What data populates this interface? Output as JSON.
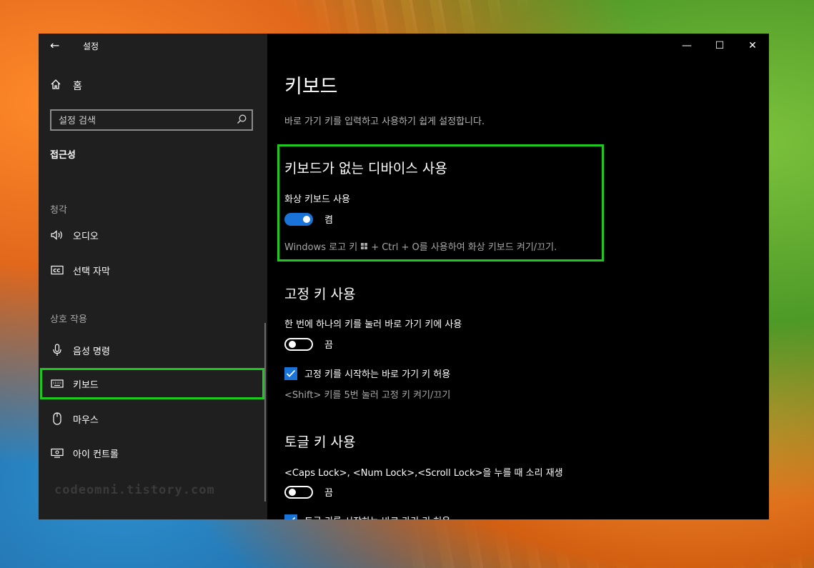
{
  "window": {
    "title": "설정",
    "controls": {
      "minimize": "—",
      "maximize": "☐",
      "close": "✕"
    }
  },
  "sidebar": {
    "home_label": "홈",
    "search_placeholder": "설정 검색",
    "category_title": "접근성",
    "sections": [
      {
        "label": "청각",
        "items": [
          {
            "label": "오디오",
            "icon": "speaker-icon"
          },
          {
            "label": "선택 자막",
            "icon": "closed-caption-icon"
          }
        ]
      },
      {
        "label": "상호 작용",
        "items": [
          {
            "label": "음성 명령",
            "icon": "microphone-icon"
          },
          {
            "label": "키보드",
            "icon": "keyboard-icon",
            "selected": true
          },
          {
            "label": "마우스",
            "icon": "mouse-icon"
          },
          {
            "label": "아이 컨트롤",
            "icon": "eye-control-icon"
          }
        ]
      }
    ],
    "watermark": "codeomni.tistory.com"
  },
  "main": {
    "title": "키보드",
    "description": "바로 가기 키를 입력하고 사용하기 쉽게 설정합니다.",
    "onscreen": {
      "heading": "키보드가 없는 디바이스 사용",
      "setting_label": "화상 키보드 사용",
      "toggle_state": "켬",
      "toggle_on": true,
      "hint_before": "Windows 로고 키",
      "hint_after": "+ Ctrl + O를 사용하여 화상 키보드 켜기/끄기."
    },
    "sticky": {
      "heading": "고정 키 사용",
      "setting_label": "한 번에 하나의 키를 눌러 바로 가기 키에 사용",
      "toggle_state": "끔",
      "toggle_on": false,
      "checkbox_label": "고정 키를 시작하는 바로 가기 키 허용",
      "checkbox_checked": true,
      "hint": "<Shift> 키를 5번 눌러 고정 키 켜기/끄기"
    },
    "toggle_keys": {
      "heading": "토글 키 사용",
      "setting_label": "<Caps Lock>, <Num Lock>,<Scroll Lock>을 누를 때 소리 재생",
      "toggle_state": "끔",
      "toggle_on": false,
      "checkbox_label": "토글 키를 시작하는 바로 가기 키 허용"
    }
  },
  "colors": {
    "accent": "#1a73d8",
    "highlight": "#1ec81e",
    "sidebar_bg": "#1f1f1f",
    "content_bg": "#000000"
  }
}
